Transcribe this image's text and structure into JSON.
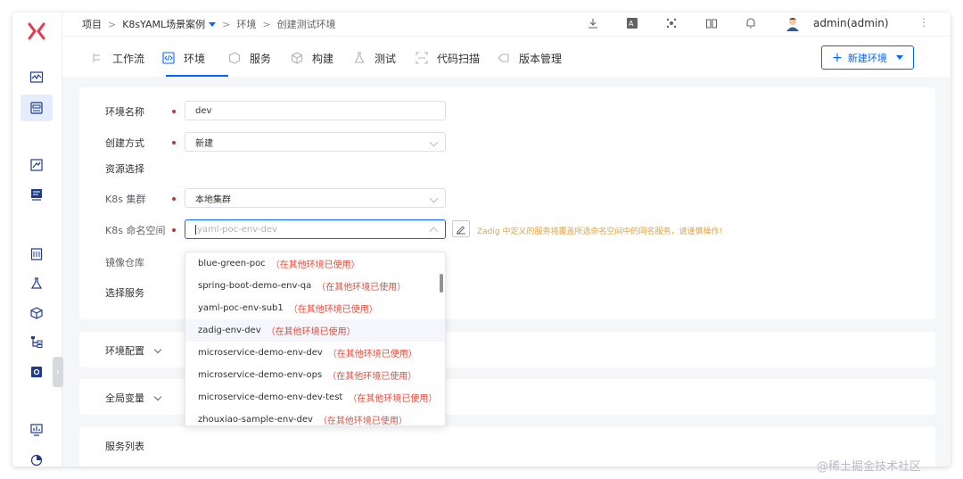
{
  "breadcrumb": {
    "root": "项目",
    "project": "K8sYAML场景案例",
    "section": "环境",
    "page": "创建测试环境"
  },
  "user": {
    "name": "admin(admin)"
  },
  "tabs": [
    {
      "label": "工作流"
    },
    {
      "label": "环境"
    },
    {
      "label": "服务"
    },
    {
      "label": "构建"
    },
    {
      "label": "测试"
    },
    {
      "label": "代码扫描"
    },
    {
      "label": "版本管理"
    }
  ],
  "new_env_button": {
    "label": "新建环境"
  },
  "form": {
    "env_name": {
      "label": "环境名称",
      "value": "dev"
    },
    "create_mode": {
      "label": "创建方式",
      "value": "新建"
    },
    "resource_section": {
      "label": "资源选择"
    },
    "k8s_cluster": {
      "label": "K8s 集群",
      "value": "本地集群"
    },
    "k8s_namespace": {
      "label": "K8s 命名空间",
      "placeholder": "yaml-poc-env-dev",
      "warning": "Zadig 中定义的服务将覆盖所选命名空间中的同名服务，请谨慎操作!"
    },
    "image_registry": {
      "label": "镜像仓库"
    },
    "select_services": {
      "label": "选择服务"
    }
  },
  "namespace_options": [
    {
      "name": "blue-green-poc",
      "note": "（在其他环境已使用）"
    },
    {
      "name": "spring-boot-demo-env-qa",
      "note": "（在其他环境已使用）"
    },
    {
      "name": "yaml-poc-env-sub1",
      "note": "（在其他环境已使用）"
    },
    {
      "name": "zadig-env-dev",
      "note": "（在其他环境已使用）"
    },
    {
      "name": "microservice-demo-env-dev",
      "note": "（在其他环境已使用）"
    },
    {
      "name": "microservice-demo-env-ops",
      "note": "（在其他环境已使用）"
    },
    {
      "name": "microservice-demo-env-dev-test",
      "note": "（在其他环境已使用）"
    },
    {
      "name": "zhouxiao-sample-env-dev",
      "note": "（在其他环境已使用）"
    }
  ],
  "sections": {
    "env_config": "环境配置",
    "global_vars": "全局变量",
    "service_list": "服务列表"
  },
  "watermark": "@稀土掘金技术社区",
  "colors": {
    "accent": "#0066ff",
    "warning": "#e6a23c",
    "danger": "#e74c3c",
    "logo": "#e8384f"
  }
}
